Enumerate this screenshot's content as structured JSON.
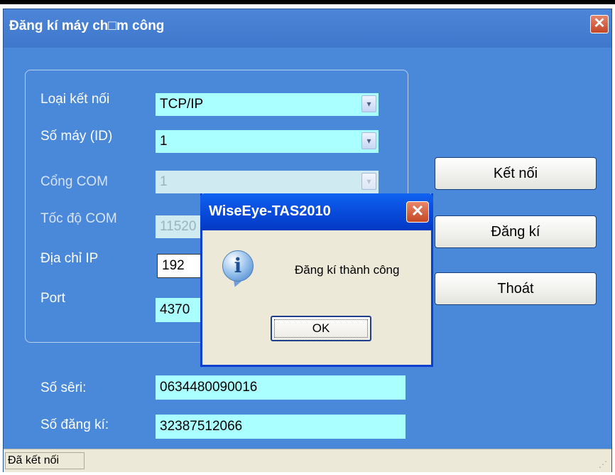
{
  "window": {
    "title": "Đăng kí máy ch□m công",
    "close_glyph": "✕"
  },
  "form": {
    "connection_type": {
      "label": "Loại kết nối",
      "value": "TCP/IP"
    },
    "machine_id": {
      "label": "Số máy (ID)",
      "value": "1"
    },
    "com_port": {
      "label": "Cổng COM",
      "value": "1"
    },
    "com_speed": {
      "label": "Tốc độ COM",
      "value": "11520"
    },
    "ip_address": {
      "label": "Địa chỉ IP",
      "value": "192"
    },
    "port": {
      "label": "Port",
      "value": "4370"
    },
    "dropdown_glyph": "▾"
  },
  "buttons": {
    "connect": "Kết nối",
    "register": "Đăng kí",
    "exit": "Thoát"
  },
  "serial": {
    "label": "Số sêri:",
    "value": "0634480090016"
  },
  "reg_number": {
    "label": "Số đăng kí:",
    "value": "32387512066"
  },
  "status": {
    "text": "Đã kết nối"
  },
  "dialog": {
    "title": "WiseEye-TAS2010",
    "message": "Đăng kí thành công",
    "ok": "OK",
    "icon_glyph": "i"
  },
  "colors": {
    "window_bg": "#4a88da",
    "field_bg": "#aaffff",
    "dialog_title": "#0747d8",
    "status_bg": "#ece9d8"
  }
}
